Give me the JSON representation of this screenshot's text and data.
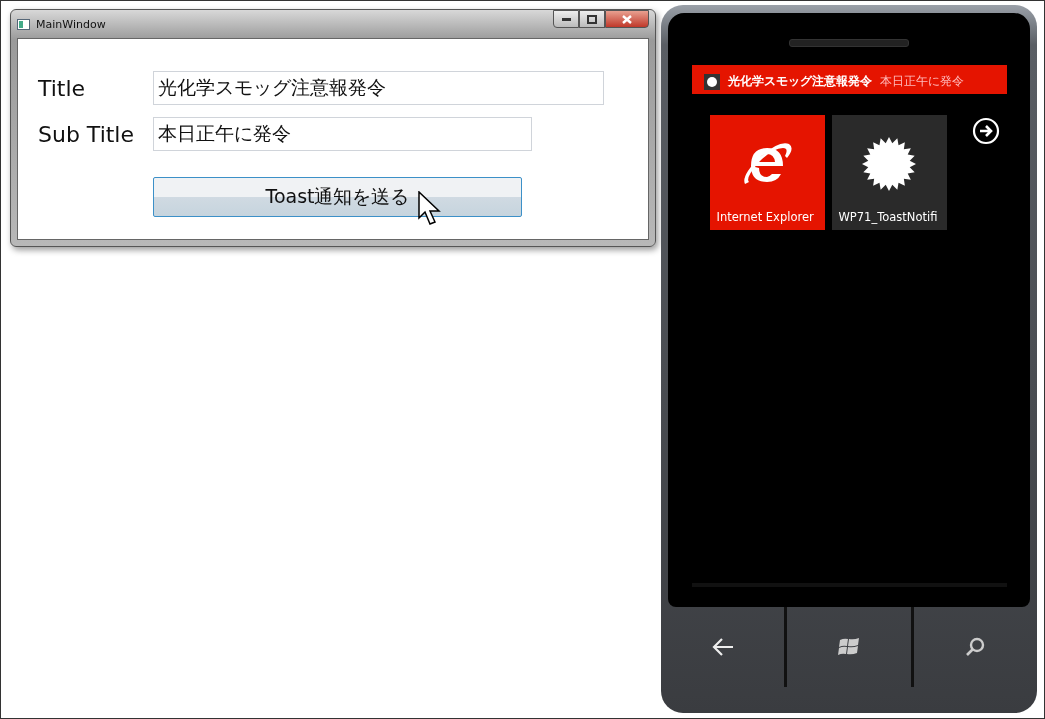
{
  "window": {
    "title": "MainWindow"
  },
  "form": {
    "fields": [
      {
        "label": "Title",
        "value": "光化学スモッグ注意報発令"
      },
      {
        "label": "Sub Title",
        "value": "本日正午に発令"
      }
    ],
    "button": "Toast通知を送る"
  },
  "phone": {
    "toast": {
      "title": "光化学スモッグ注意報発令",
      "subtitle": "本日正午に発令"
    },
    "tiles": [
      {
        "label": "Internet Explorer",
        "kind": "browser",
        "color": "#e51400"
      },
      {
        "label": "WP71_ToastNotifi",
        "kind": "app",
        "color": "#2a2a2a"
      }
    ]
  }
}
